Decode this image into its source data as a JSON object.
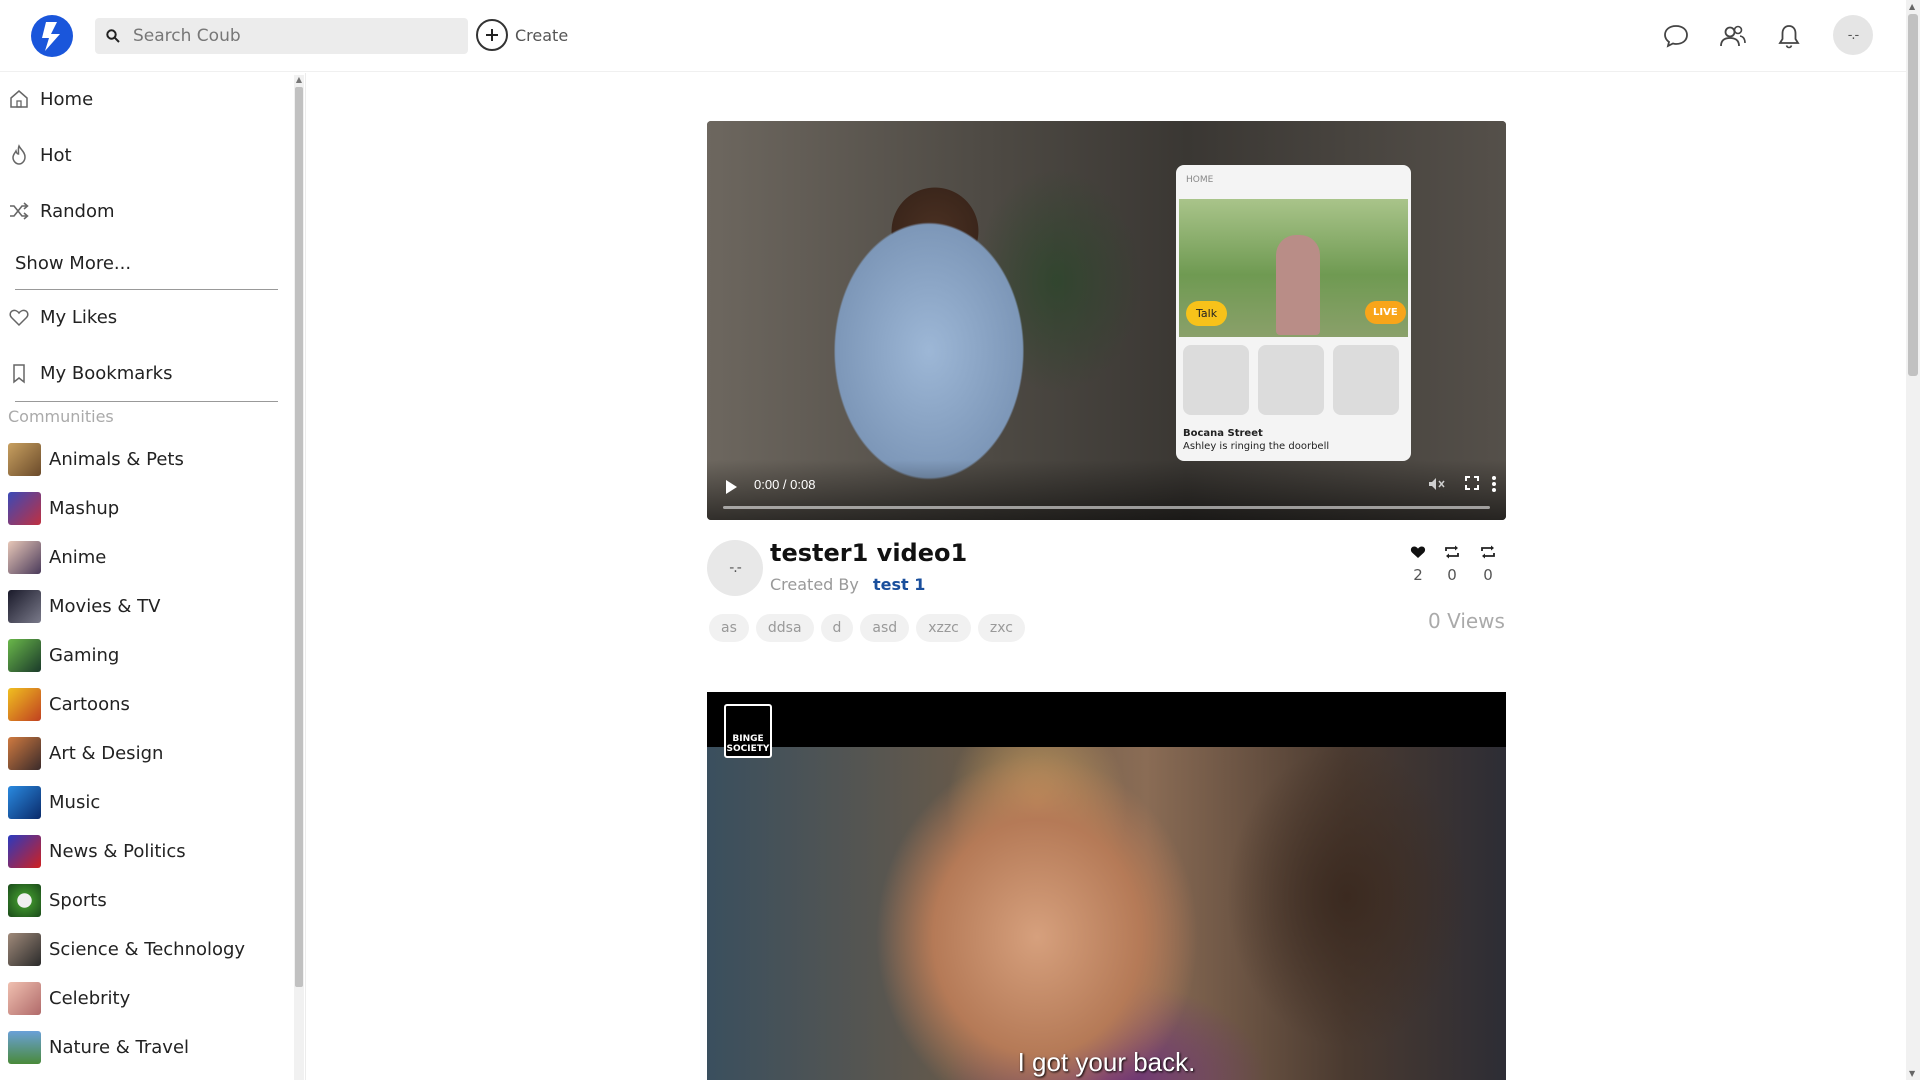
{
  "header": {
    "search_placeholder": "Search Coub",
    "create_label": "Create",
    "avatar_text": "-.-"
  },
  "sidebar": {
    "main_items": [
      {
        "label": "Home",
        "icon": "home-icon"
      },
      {
        "label": "Hot",
        "icon": "flame-icon"
      },
      {
        "label": "Random",
        "icon": "shuffle-icon"
      }
    ],
    "show_more": "Show More...",
    "personal_items": [
      {
        "label": "My Likes",
        "icon": "heart-icon"
      },
      {
        "label": "My Bookmarks",
        "icon": "bookmark-icon"
      }
    ],
    "communities_heading": "Communities",
    "communities": [
      {
        "label": "Animals & Pets",
        "color": "#8a6a3a"
      },
      {
        "label": "Mashup",
        "color": "#2a3a8a"
      },
      {
        "label": "Anime",
        "color": "#b88a7a"
      },
      {
        "label": "Movies & TV",
        "color": "#222244"
      },
      {
        "label": "Gaming",
        "color": "#2e7a3e"
      },
      {
        "label": "Cartoons",
        "color": "#e0a020"
      },
      {
        "label": "Art & Design",
        "color": "#a06040"
      },
      {
        "label": "Music",
        "color": "#1a6ab8"
      },
      {
        "label": "News & Politics",
        "color": "#c02030"
      },
      {
        "label": "Sports",
        "color": "#3a7a2a"
      },
      {
        "label": "Science & Technology",
        "color": "#5a4a3a"
      },
      {
        "label": "Celebrity",
        "color": "#d08a8a"
      },
      {
        "label": "Nature & Travel",
        "color": "#4a7aa0"
      }
    ]
  },
  "post1": {
    "video_time": "0:00 / 0:08",
    "card_home": "HOME",
    "card_talk": "Talk",
    "card_live": "LIVE",
    "card_street": "Bocana Street",
    "card_message": "Ashley is ringing the doorbell",
    "avatar_text": "-.-",
    "title": "tester1 video1",
    "created_by": "Created By",
    "creator": "test 1",
    "likes": "2",
    "recoubs": "0",
    "shares": "0",
    "tags": [
      "as",
      "ddsa",
      "d",
      "asd",
      "xzzc",
      "zxc"
    ],
    "views": "0 Views"
  },
  "post2": {
    "badge": "BINGE SOCIETY",
    "caption": "I got your back."
  }
}
